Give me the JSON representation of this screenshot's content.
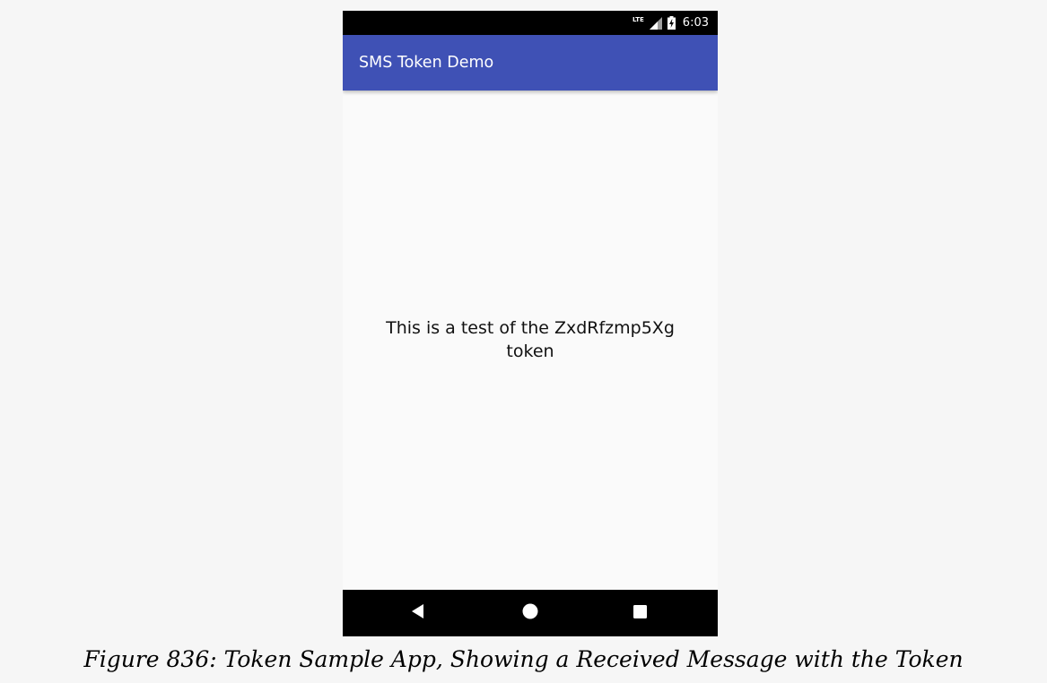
{
  "status_bar": {
    "network_label": "LTE",
    "time": "6:03"
  },
  "app_bar": {
    "title": "SMS Token Demo",
    "color": "#3f51b5"
  },
  "main": {
    "message": "This is a test of the ZxdRfzmp5Xg token"
  },
  "nav_bar": {
    "buttons": [
      "back-icon",
      "home-icon",
      "recents-icon"
    ]
  },
  "caption": "Figure 836: Token Sample App, Showing a Received Message with the Token"
}
